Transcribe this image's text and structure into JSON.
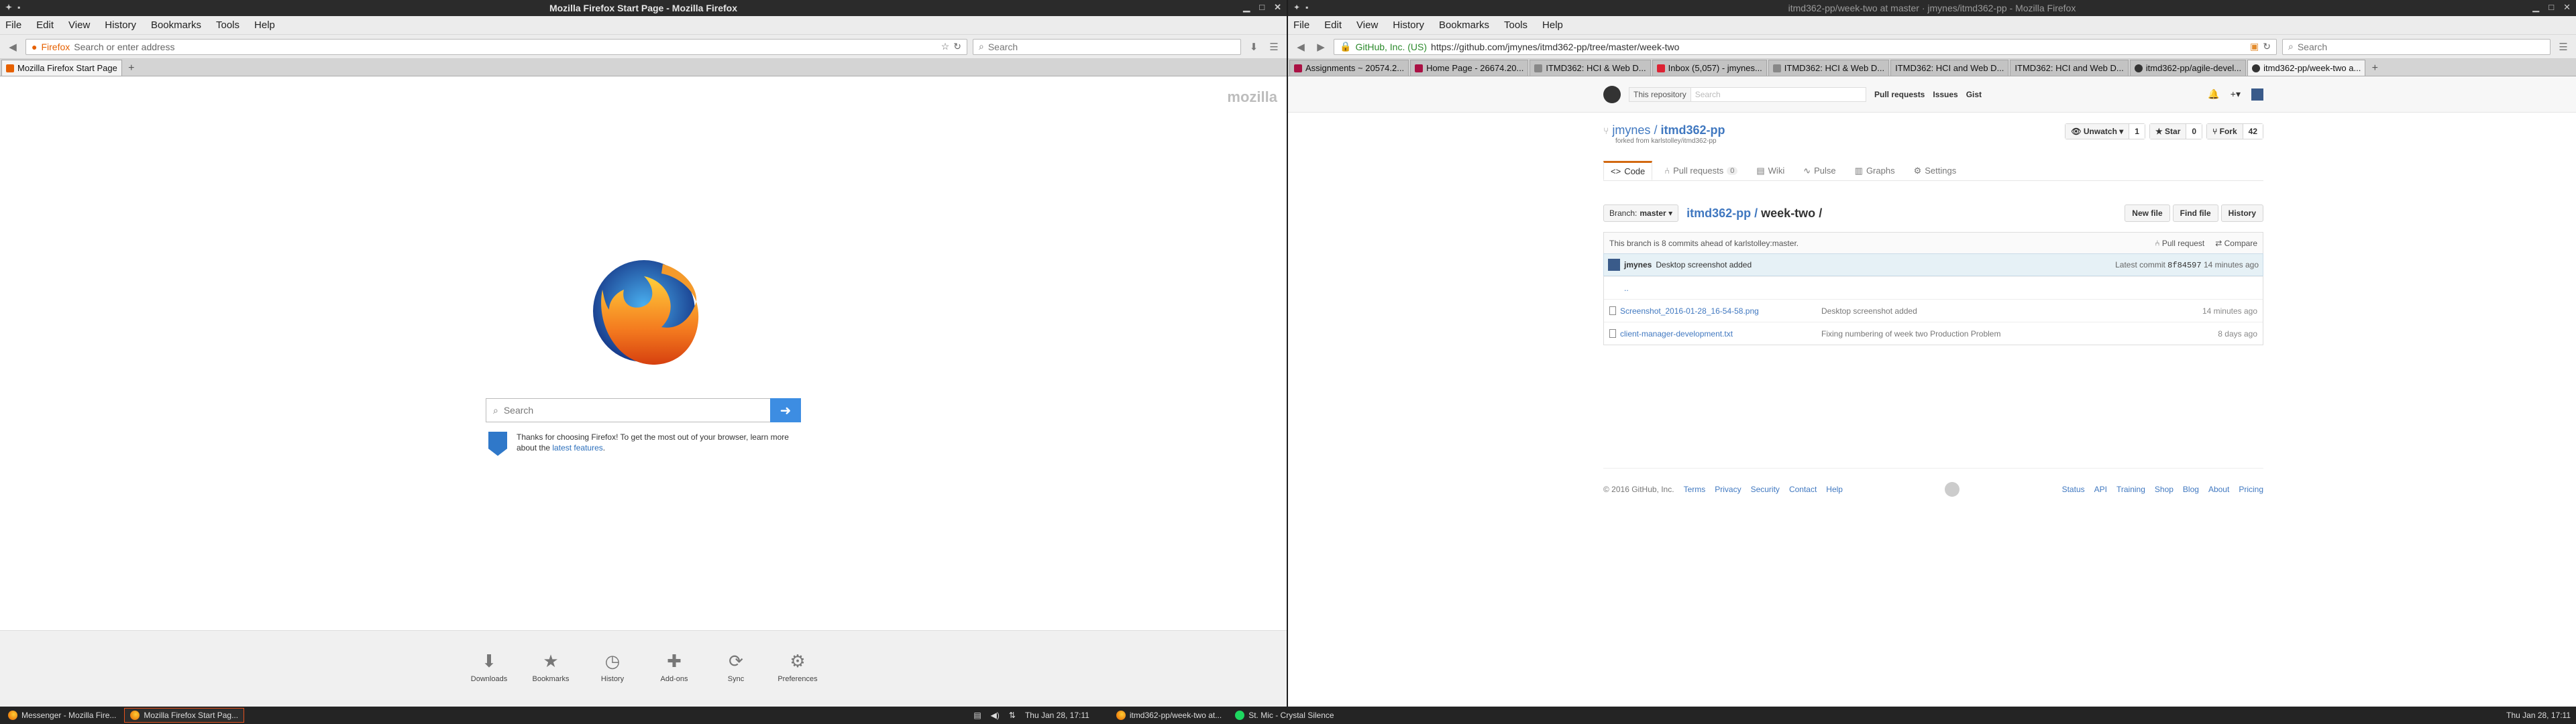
{
  "left_window": {
    "title": "Mozilla Firefox Start Page - Mozilla Firefox",
    "menu": [
      "File",
      "Edit",
      "View",
      "History",
      "Bookmarks",
      "Tools",
      "Help"
    ],
    "url_identity": "Firefox",
    "url_placeholder": "Search or enter address",
    "search_placeholder": "Search",
    "tabs": [
      {
        "label": "Mozilla Firefox Start Page"
      }
    ],
    "page": {
      "brand": "mozilla",
      "search_placeholder": "Search",
      "snippet_text": "Thanks for choosing Firefox! To get the most out of your browser, learn more about the",
      "snippet_link": "latest features",
      "snippet_end": ".",
      "footer": [
        "Downloads",
        "Bookmarks",
        "History",
        "Add-ons",
        "Sync",
        "Preferences"
      ]
    }
  },
  "right_window": {
    "title": "itmd362-pp/week-two at master · jmynes/itmd362-pp - Mozilla Firefox",
    "menu": [
      "File",
      "Edit",
      "View",
      "History",
      "Bookmarks",
      "Tools",
      "Help"
    ],
    "url_identity": "GitHub, Inc. (US)",
    "url": "https://github.com/jmynes/itmd362-pp/tree/master/week-two",
    "search_placeholder": "Search",
    "tabs": [
      {
        "label": "Assignments ~ 20574.2..."
      },
      {
        "label": "Home Page - 26674.20..."
      },
      {
        "label": "ITMD362: HCI & Web D..."
      },
      {
        "label": "Inbox (5,057) - jmynes..."
      },
      {
        "label": "ITMD362: HCI & Web D..."
      },
      {
        "label": "ITMD362: HCI and Web D..."
      },
      {
        "label": "ITMD362: HCI and Web D..."
      },
      {
        "label": "itmd362-pp/agile-devel..."
      },
      {
        "label": "itmd362-pp/week-two a..."
      }
    ],
    "github": {
      "scope": "This repository",
      "search_placeholder": "Search",
      "header_links": [
        "Pull requests",
        "Issues",
        "Gist"
      ],
      "owner": "jmynes",
      "repo": "itmd362-pp",
      "forked_from": "forked from karlstolley/itmd362-pp",
      "unwatch": "Unwatch",
      "unwatch_count": "1",
      "star": "Star",
      "star_count": "0",
      "fork": "Fork",
      "fork_count": "42",
      "nav": [
        {
          "label": "Code"
        },
        {
          "label": "Pull requests",
          "count": "0"
        },
        {
          "label": "Wiki"
        },
        {
          "label": "Pulse"
        },
        {
          "label": "Graphs"
        },
        {
          "label": "Settings"
        }
      ],
      "branch_label": "Branch:",
      "branch": "master",
      "crumb_repo": "itmd362-pp",
      "crumb_sep": "/",
      "crumb_dir": "week-two",
      "crumb_end": "/",
      "file_buttons": [
        "New file",
        "Find file",
        "History"
      ],
      "branch_info": "This branch is 8 commits ahead of karlstolley:master.",
      "pull_request": "Pull request",
      "compare": "Compare",
      "commit_author": "jmynes",
      "commit_msg": "Desktop screenshot added",
      "latest_commit_label": "Latest commit",
      "commit_sha": "8f84597",
      "commit_age": "14 minutes ago",
      "parent_dir": "..",
      "files": [
        {
          "name": "Screenshot_2016-01-28_16-54-58.png",
          "msg": "Desktop screenshot added",
          "age": "14 minutes ago"
        },
        {
          "name": "client-manager-development.txt",
          "msg": "Fixing numbering of week two Production Problem",
          "age": "8 days ago"
        }
      ],
      "footer_copy": "© 2016 GitHub, Inc.",
      "footer_left": [
        "Terms",
        "Privacy",
        "Security",
        "Contact",
        "Help"
      ],
      "footer_right": [
        "Status",
        "API",
        "Training",
        "Shop",
        "Blog",
        "About",
        "Pricing"
      ]
    }
  },
  "taskbar": {
    "left_tasks": [
      {
        "label": "Messenger - Mozilla Fire..."
      },
      {
        "label": "Mozilla Firefox Start Pag..."
      }
    ],
    "left_clock": "Thu Jan 28, 17:11",
    "right_tasks": [
      {
        "label": "itmd362-pp/week-two at..."
      },
      {
        "label": "St. Mic - Crystal Silence"
      }
    ],
    "right_clock": "Thu Jan 28, 17:11"
  },
  "colors": {
    "accent": "#3d8de2",
    "github_link": "#4078c0",
    "active_tab_border": "#d26911",
    "taskbar_active": "#e4521e"
  }
}
